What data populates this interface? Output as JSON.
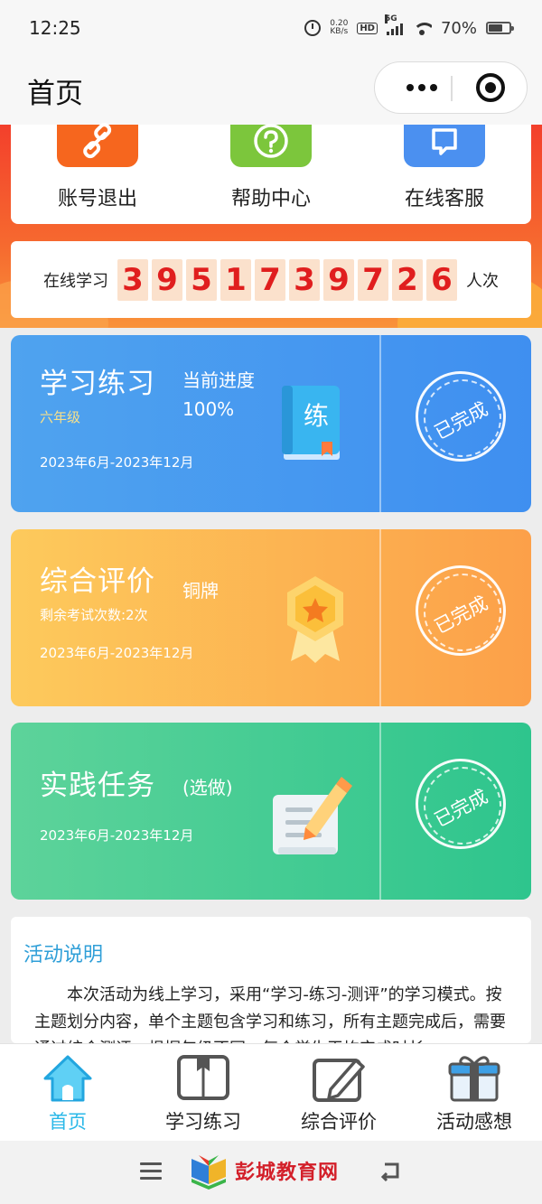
{
  "status_bar": {
    "time": "12:25",
    "net_speed_value": "0.20",
    "net_speed_unit": "KB/s",
    "hd": "HD",
    "signal": "5G",
    "battery": "70%",
    "battery_level": 0.7
  },
  "nav": {
    "title": "首页"
  },
  "quick_links": [
    {
      "label": "账号退出",
      "icon": "link-icon",
      "color": "#f6661e"
    },
    {
      "label": "帮助中心",
      "icon": "question-icon",
      "color": "#7cc63c"
    },
    {
      "label": "在线客服",
      "icon": "chat-icon",
      "color": "#4b90f0"
    }
  ],
  "counter": {
    "prefix": "在线学习",
    "digits": [
      "3",
      "9",
      "5",
      "1",
      "7",
      "3",
      "9",
      "7",
      "2",
      "6"
    ],
    "suffix": "人次"
  },
  "tasks": [
    {
      "title": "学习练习",
      "subtitle": "当前进度",
      "progress": "100%",
      "meta": "六年级",
      "date": "2023年6月-2023年12月",
      "badge_char": "练",
      "stamp": "已完成",
      "color": "#4a9af0"
    },
    {
      "title": "综合评价",
      "subtitle": "铜牌",
      "meta": "剩余考试次数:2次",
      "date": "2023年6月-2023年12月",
      "stamp": "已完成",
      "color": "#fcb652"
    },
    {
      "title": "实践任务",
      "subtitle": "(选做)",
      "date": "2023年6月-2023年12月",
      "stamp": "已完成",
      "color": "#45cc94"
    }
  ],
  "activity": {
    "title": "活动说明",
    "body": "本次活动为线上学习，采用“学习-练习-测评”的学习模式。按主题划分内容，单个主题包含学习和练习，所有主题完成后，需要通过综合测评，根据年级不同，每个学生平均完成时长"
  },
  "tabbar": [
    {
      "label": "首页",
      "icon": "home-icon",
      "active": true
    },
    {
      "label": "学习练习",
      "icon": "book-icon",
      "active": false
    },
    {
      "label": "综合评价",
      "icon": "edit-icon",
      "active": false
    },
    {
      "label": "活动感想",
      "icon": "gift-icon",
      "active": false
    }
  ],
  "footer": {
    "logo_text": "彭城教育网"
  },
  "colors": {
    "accent": "#2ab8e8",
    "banner": "#f3402c",
    "digit_red": "#e01e1e"
  }
}
